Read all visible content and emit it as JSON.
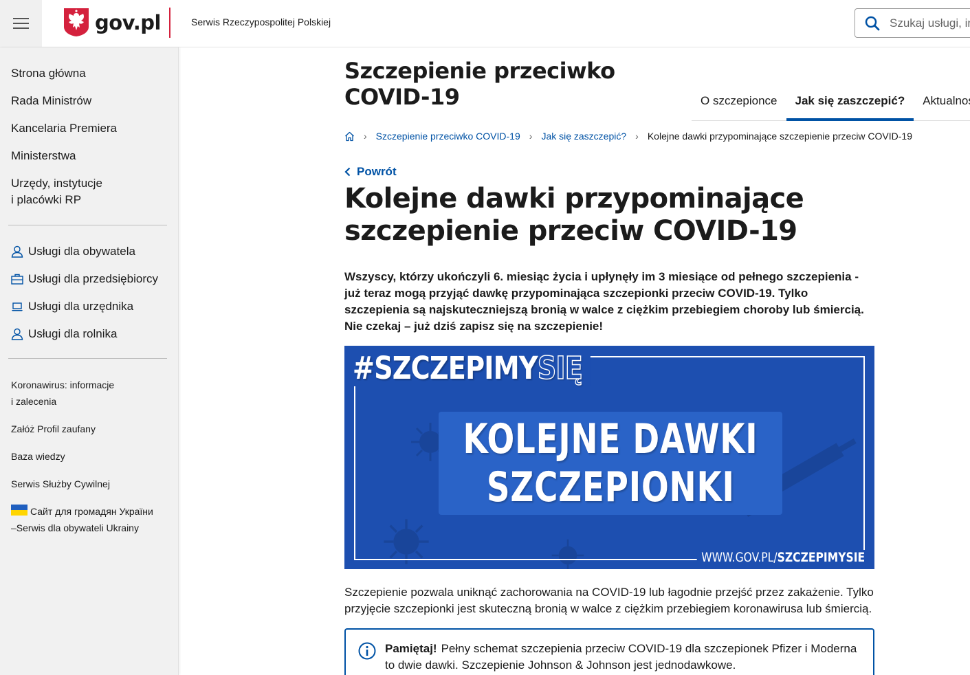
{
  "header": {
    "logo_text": "gov.pl",
    "service_name": "Serwis Rzeczypospolitej Polskiej",
    "search_placeholder": "Szukaj usługi, in"
  },
  "sidebar": {
    "main_items": [
      {
        "label": "Strona główna"
      },
      {
        "label": "Rada Ministrów"
      },
      {
        "label": "Kancelaria Premiera"
      },
      {
        "label": "Ministerstwa"
      },
      {
        "label_line1": "Urzędy, instytucje",
        "label_line2": "i placówki RP"
      }
    ],
    "services": [
      {
        "label": "Usługi dla obywatela",
        "icon": "person-icon"
      },
      {
        "label": "Usługi dla przedsiębiorcy",
        "icon": "briefcase-icon"
      },
      {
        "label": "Usługi dla urzędnika",
        "icon": "laptop-icon"
      },
      {
        "label": "Usługi dla rolnika",
        "icon": "person-icon"
      }
    ],
    "links": [
      {
        "label_line1": "Koronawirus: informacje",
        "label_line2": "i zalecenia"
      },
      {
        "label": "Załóż Profil zaufany"
      },
      {
        "label": "Baza wiedzy"
      },
      {
        "label": "Serwis Służby Cywilnej"
      },
      {
        "label_line1": "Сайт для громадян України",
        "label_line2": "–Serwis dla obywateli Ukrainy"
      }
    ]
  },
  "section": {
    "title_line1": "Szczepienie przeciwko",
    "title_line2": "COVID-19",
    "tabs": [
      {
        "label": "O szczepionce",
        "active": false
      },
      {
        "label": "Jak się zaszczepić?",
        "active": true
      },
      {
        "label": "Aktualności",
        "active": false
      }
    ]
  },
  "breadcrumb": {
    "items": [
      "Szczepienie przeciwko COVID-19",
      "Jak się zaszczepić?"
    ],
    "current": "Kolejne dawki przypominające szczepienie przeciw COVID-19"
  },
  "back_label": "Powrót",
  "article": {
    "title_line1": "Kolejne dawki przypominające",
    "title_line2": "szczepienie przeciw COVID-19",
    "lead": "Wszyscy, którzy ukończyli 6. miesiąc życia i upłynęły im 3 miesiące od pełnego szczepienia - już teraz mogą przyjąć dawkę przypominająca szczepionki przeciw COVID-19. Tylko szczepienia są najskuteczniejszą bronią w walce z ciężkim przebiegiem choroby lub śmiercią. Nie czekaj – już dziś zapisz się na szczepienie!",
    "banner": {
      "hashtag_main": "#SZCZEPIMY",
      "hashtag_outline": "SIĘ",
      "line1": "KOLEJNE DAWKI",
      "line2": "SZCZEPIONKI",
      "url_prefix": "WWW.GOV.PL/",
      "url_bold": "SZCZEPIMYSIE"
    },
    "body": "Szczepienie pozwala uniknąć zachorowania na COVID-19 lub łagodnie przejść przez zakażenie. Tylko przyjęcie szczepionki jest skuteczną bronią w walce z ciężkim przebiegiem koronawirusa lub śmiercią.",
    "info": {
      "label": "Pamiętaj!",
      "text": "Pełny schemat szczepienia przeciw COVID-19 dla szczepionek Pfizer i Moderna to dwie dawki. Szczepienie Johnson & Johnson jest jednodawkowe."
    }
  },
  "colors": {
    "accent_blue": "#0052a5",
    "gov_red": "#d4213d",
    "banner_blue": "#1d4fb0",
    "sidebar_bg": "#f1f1f1"
  }
}
